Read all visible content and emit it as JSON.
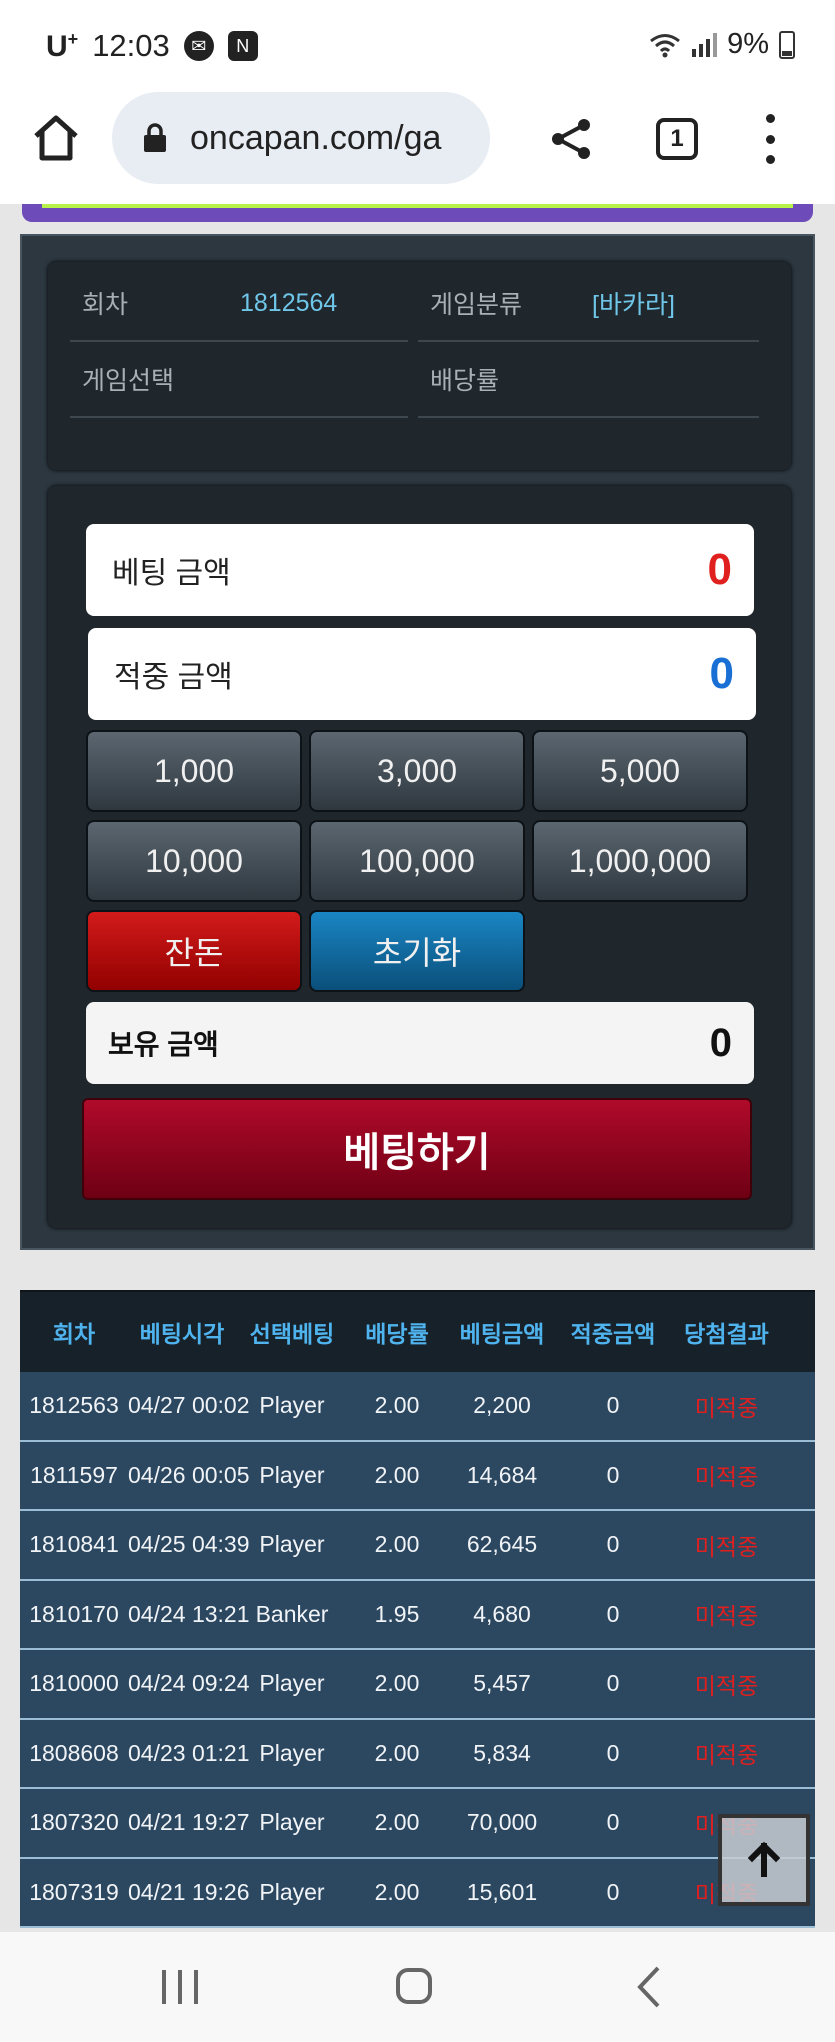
{
  "status_bar": {
    "carrier": "U",
    "carrier_sup": "+",
    "time": "12:03",
    "battery": "9%"
  },
  "browser": {
    "url": "oncapan.com/ga",
    "tab_count": "1"
  },
  "info": {
    "round_label": "회차",
    "round_value": "1812564",
    "category_label": "게임분류",
    "category_value": "[바카라]",
    "select_label": "게임선택",
    "select_value": "",
    "odds_label": "배당률",
    "odds_value": ""
  },
  "betting": {
    "bet_amount_label": "베팅 금액",
    "bet_amount_value": "0",
    "win_amount_label": "적중 금액",
    "win_amount_value": "0",
    "chips": [
      "1,000",
      "3,000",
      "5,000",
      "10,000",
      "100,000",
      "1,000,000"
    ],
    "change_label": "잔돈",
    "reset_label": "초기화",
    "hold_label": "보유 금액",
    "hold_value": "0",
    "submit_label": "베팅하기"
  },
  "history": {
    "headers": [
      "회차",
      "베팅시각",
      "선택베팅",
      "배당률",
      "베팅금액",
      "적중금액",
      "당첨결과"
    ],
    "rows": [
      [
        "1812563",
        "04/27 00:02",
        "Player",
        "2.00",
        "2,200",
        "0",
        "미적중"
      ],
      [
        "1811597",
        "04/26 00:05",
        "Player",
        "2.00",
        "14,684",
        "0",
        "미적중"
      ],
      [
        "1810841",
        "04/25 04:39",
        "Player",
        "2.00",
        "62,645",
        "0",
        "미적중"
      ],
      [
        "1810170",
        "04/24 13:21",
        "Banker",
        "1.95",
        "4,680",
        "0",
        "미적중"
      ],
      [
        "1810000",
        "04/24 09:24",
        "Player",
        "2.00",
        "5,457",
        "0",
        "미적중"
      ],
      [
        "1808608",
        "04/23 01:21",
        "Player",
        "2.00",
        "5,834",
        "0",
        "미적중"
      ],
      [
        "1807320",
        "04/21 19:27",
        "Player",
        "2.00",
        "70,000",
        "0",
        "미적중"
      ],
      [
        "1807319",
        "04/21 19:26",
        "Player",
        "2.00",
        "15,601",
        "0",
        "미적중"
      ]
    ]
  },
  "colors": {
    "bet_value": "#e0201f",
    "win_value": "#1a6fd4",
    "result_red": "#e01f1f",
    "header_blue": "#4fb3ee"
  }
}
